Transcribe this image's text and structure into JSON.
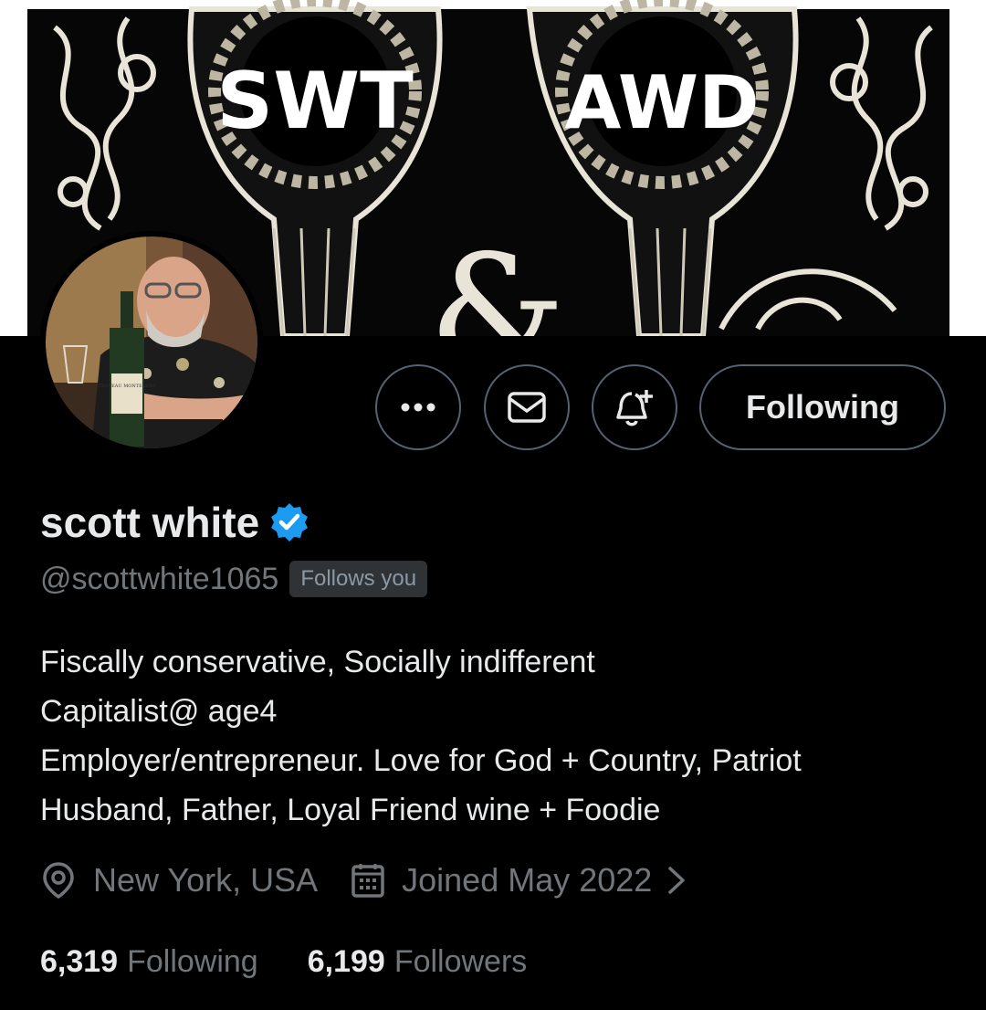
{
  "banner": {
    "left_monogram": "SWT",
    "right_monogram": "AWD",
    "ampersand": "&"
  },
  "avatar": {
    "label_text": "CHATEAU MONTELENA"
  },
  "actions": {
    "more_icon": "more-horizontal-icon",
    "message_icon": "envelope-icon",
    "notify_icon": "bell-plus-icon",
    "follow_label": "Following"
  },
  "profile": {
    "name": "scott white",
    "verified_icon": "verified-badge-icon",
    "handle": "@scottwhite1065",
    "follows_you": "Follows you",
    "bio": [
      "Fiscally conservative, Socially indifferent",
      "Capitalist@ age4",
      "Employer/entrepreneur. Love for God + Country, Patriot",
      "Husband, Father, Loyal Friend wine + Foodie"
    ],
    "location_icon": "location-pin-icon",
    "location": "New York, USA",
    "joined_icon": "calendar-icon",
    "joined": "Joined May 2022",
    "chevron_icon": "chevron-right-icon"
  },
  "stats": {
    "following_count": "6,319",
    "following_label": "Following",
    "followers_count": "6,199",
    "followers_label": "Followers"
  },
  "colors": {
    "background": "#000000",
    "text_primary": "#e7e9ea",
    "text_secondary": "#71767b",
    "verified_blue": "#1d9bf0",
    "button_border": "#536471"
  }
}
